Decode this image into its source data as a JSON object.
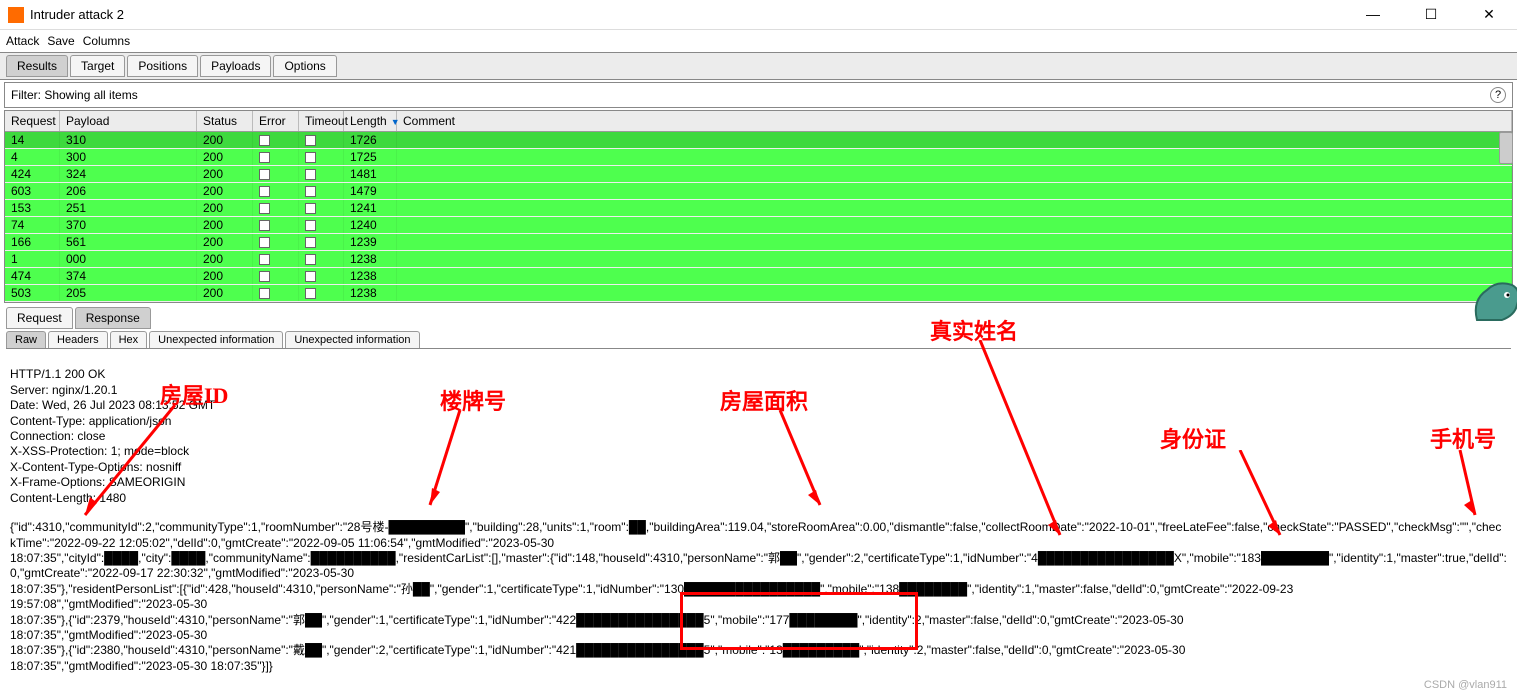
{
  "window": {
    "title": "Intruder attack 2"
  },
  "menu": {
    "attack": "Attack",
    "save": "Save",
    "columns": "Columns"
  },
  "maintabs": {
    "results": "Results",
    "target": "Target",
    "positions": "Positions",
    "payloads": "Payloads",
    "options": "Options"
  },
  "filter": {
    "text": "Filter: Showing all items"
  },
  "columns": {
    "request": "Request",
    "payload": "Payload",
    "status": "Status",
    "error": "Error",
    "timeout": "Timeout",
    "length": "Length",
    "comment": "Comment"
  },
  "rows": [
    {
      "req": "14",
      "pay": "310",
      "status": "200",
      "len": "1726"
    },
    {
      "req": "4",
      "pay": "300",
      "status": "200",
      "len": "1725"
    },
    {
      "req": "424",
      "pay": "324",
      "status": "200",
      "len": "1481"
    },
    {
      "req": "603",
      "pay": "206",
      "status": "200",
      "len": "1479"
    },
    {
      "req": "153",
      "pay": "251",
      "status": "200",
      "len": "1241"
    },
    {
      "req": "74",
      "pay": "370",
      "status": "200",
      "len": "1240"
    },
    {
      "req": "166",
      "pay": "561",
      "status": "200",
      "len": "1239"
    },
    {
      "req": "1",
      "pay": "000",
      "status": "200",
      "len": "1238"
    },
    {
      "req": "474",
      "pay": "374",
      "status": "200",
      "len": "1238"
    },
    {
      "req": "503",
      "pay": "205",
      "status": "200",
      "len": "1238"
    }
  ],
  "reqres": {
    "request": "Request",
    "response": "Response"
  },
  "viewtabs": {
    "raw": "Raw",
    "headers": "Headers",
    "hex": "Hex",
    "unexpected1": "Unexpected information",
    "unexpected2": "Unexpected information"
  },
  "http": {
    "line1": "HTTP/1.1 200 OK",
    "line2": "Server: nginx/1.20.1",
    "line3": "Date: Wed, 26 Jul 2023 08:13:52 GMT",
    "line4": "Content-Type: application/json",
    "line5": "Connection: close",
    "line6": "X-XSS-Protection: 1; mode=block",
    "line7": "X-Content-Type-Options: nosniff",
    "line8": "X-Frame-Options: SAMEORIGIN",
    "line9": "Content-Length: 1480"
  },
  "json_body": "{\"id\":4310,\"communityId\":2,\"communityType\":1,\"roomNumber\":\"28号楼-█████████\",\"building\":28,\"units\":1,\"room\":██,\"buildingArea\":119.04,\"storeRoomArea\":0.00,\"dismantle\":false,\"collectRoomDate\":\"2022-10-01\",\"freeLateFee\":false,\"checkState\":\"PASSED\",\"checkMsg\":\"\",\"checkTime\":\"2022-09-22 12:05:02\",\"delId\":0,\"gmtCreate\":\"2022-09-05 11:06:54\",\"gmtModified\":\"2023-05-30\n18:07:35\",\"cityId\":████,\"city\":████,\"communityName\":██████████,\"residentCarList\":[],\"master\":{\"id\":148,\"houseId\":4310,\"personName\":\"郭██\",\"gender\":2,\"certificateType\":1,\"idNumber\":\"4████████████████X\",\"mobile\":\"183████████\",\"identity\":1,\"master\":true,\"delId\":0,\"gmtCreate\":\"2022-09-17 22:30:32\",\"gmtModified\":\"2023-05-30\n18:07:35\"},\"residentPersonList\":[{\"id\":428,\"houseId\":4310,\"personName\":\"孙██\",\"gender\":1,\"certificateType\":1,\"idNumber\":\"130████████████████\",\"mobile\":\"138████████\",\"identity\":1,\"master\":false,\"delId\":0,\"gmtCreate\":\"2022-09-23\n19:57:08\",\"gmtModified\":\"2023-05-30\n18:07:35\"},{\"id\":2379,\"houseId\":4310,\"personName\":\"郭██\",\"gender\":1,\"certificateType\":1,\"idNumber\":\"422███████████████5\",\"mobile\":\"177████████\",\"identity\":2,\"master\":false,\"delId\":0,\"gmtCreate\":\"2023-05-30\n18:07:35\",\"gmtModified\":\"2023-05-30\n18:07:35\"},{\"id\":2380,\"houseId\":4310,\"personName\":\"戴██\",\"gender\":2,\"certificateType\":1,\"idNumber\":\"421███████████████5\",\"mobile\":\"13█████████\",\"identity\":2,\"master\":false,\"delId\":0,\"gmtCreate\":\"2023-05-30\n18:07:35\",\"gmtModified\":\"2023-05-30 18:07:35\"}]}",
  "annotations": {
    "houseid": "房屋ID",
    "building": "楼牌号",
    "area": "房屋面积",
    "realname": "真实姓名",
    "idcard": "身份证",
    "mobile": "手机号"
  },
  "watermark": "CSDN @vlan911"
}
